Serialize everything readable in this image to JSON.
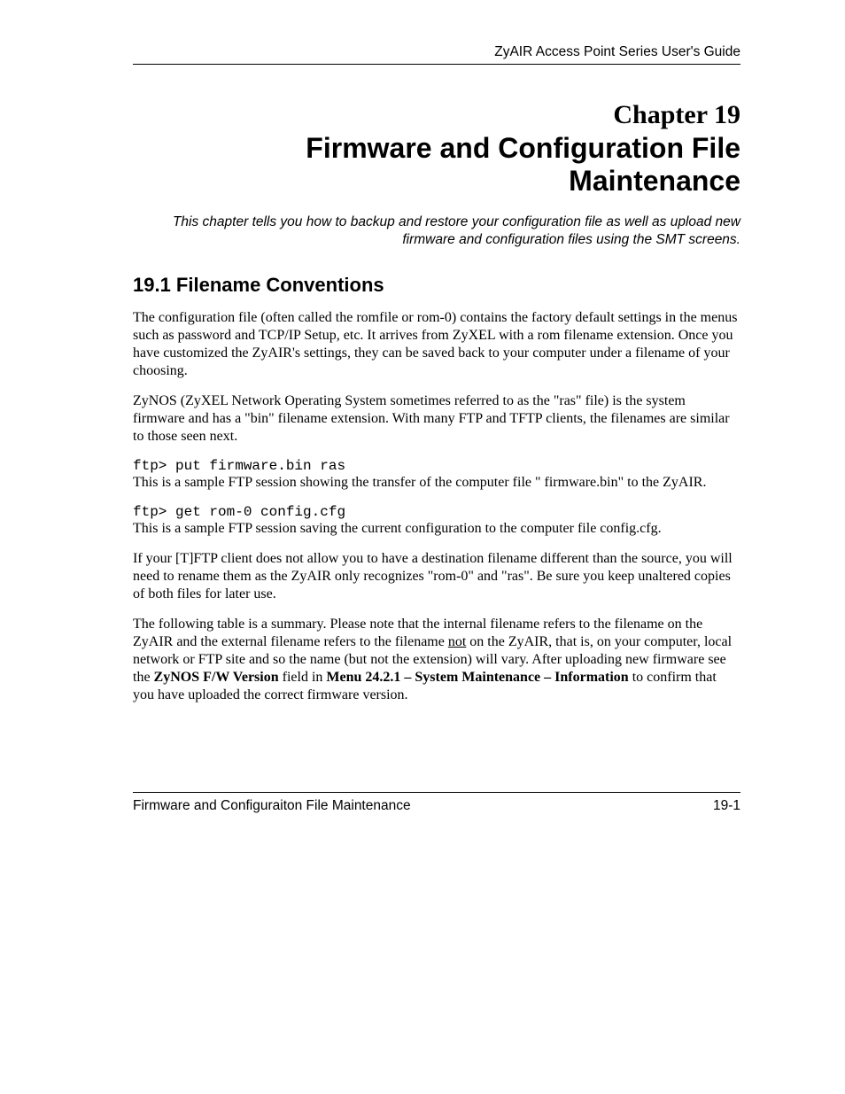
{
  "header": {
    "guide_title": "ZyAIR Access Point Series User's Guide"
  },
  "chapter": {
    "number_label": "Chapter 19",
    "title": "Firmware and Configuration File Maintenance",
    "subtitle": "This chapter tells you how to backup and restore your configuration file as well as upload new firmware and configuration files using the SMT screens."
  },
  "section": {
    "heading": "19.1  Filename Conventions",
    "para1": "The configuration file (often called the romfile or rom-0) contains the factory default settings in the menus such as password and TCP/IP Setup, etc. It arrives from ZyXEL with a rom filename extension. Once you have customized the ZyAIR's settings, they can be saved back to your computer under a filename of your choosing.",
    "para2": "ZyNOS (ZyXEL Network Operating System sometimes referred to as the \"ras\" file) is the system firmware and has a \"bin\" filename extension. With many FTP and TFTP clients, the filenames are similar to those seen next.",
    "code1": "ftp> put firmware.bin ras",
    "para3": "This is a sample FTP session showing the transfer of the computer file \" firmware.bin\" to the ZyAIR.",
    "code2": "ftp> get rom-0 config.cfg",
    "para4": "This is a sample FTP session saving the current configuration to the computer file config.cfg.",
    "para5": "If your [T]FTP client does not allow you to have a destination filename different than the source, you will need to rename them as the ZyAIR only recognizes \"rom-0\" and \"ras\". Be sure you keep unaltered copies of both files for later use.",
    "para6_a": "The following table is a summary. Please note that the internal filename refers to the filename on the ZyAIR and the external filename refers to the filename ",
    "para6_not": "not",
    "para6_b": " on the ZyAIR, that is, on your computer, local network or FTP site and so the name (but not the extension) will vary. After uploading new firmware see the ",
    "para6_bold1": "ZyNOS F/W Version",
    "para6_c": " field in ",
    "para6_bold2": "Menu 24.2.1 – System Maintenance – Information",
    "para6_d": " to confirm that you have uploaded the correct firmware version."
  },
  "footer": {
    "left": "Firmware and Configuraiton File Maintenance",
    "right": "19-1"
  }
}
